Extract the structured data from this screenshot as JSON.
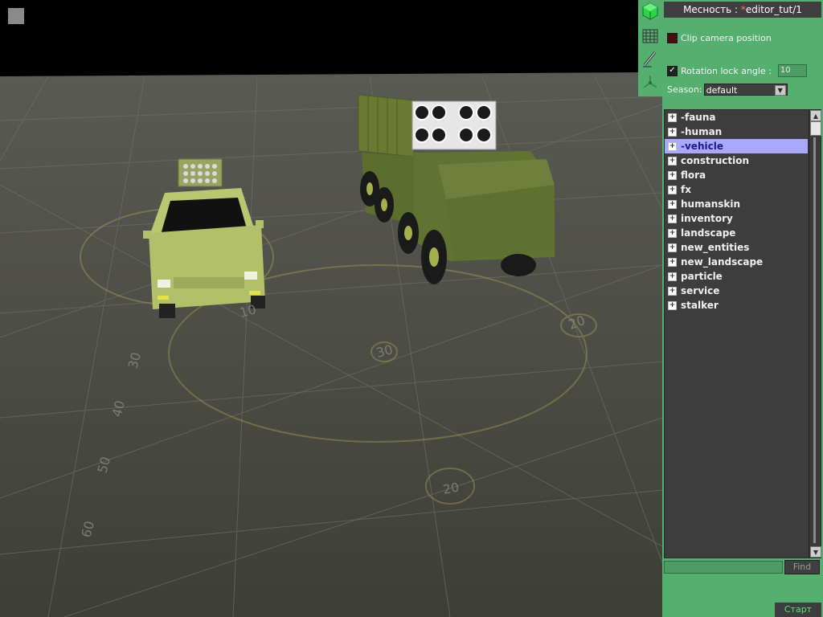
{
  "panel": {
    "title_prefix": "Месность : ",
    "title_dirty_mark": "*",
    "title_map": "editor_tut/1",
    "clip_camera": {
      "label": "Clip camera position",
      "checked": false
    },
    "rotation_lock": {
      "label": "Rotation lock angle :",
      "checked": true,
      "value": "10"
    },
    "season": {
      "label": "Season:",
      "value": "default"
    },
    "tree_items": [
      {
        "label": "-fauna",
        "selected": false
      },
      {
        "label": "-human",
        "selected": false
      },
      {
        "label": "-vehicle",
        "selected": true
      },
      {
        "label": "construction",
        "selected": false
      },
      {
        "label": "flora",
        "selected": false
      },
      {
        "label": "fx",
        "selected": false
      },
      {
        "label": "humanskin",
        "selected": false
      },
      {
        "label": "inventory",
        "selected": false
      },
      {
        "label": "landscape",
        "selected": false
      },
      {
        "label": "new_entities",
        "selected": false
      },
      {
        "label": "new_landscape",
        "selected": false
      },
      {
        "label": "particle",
        "selected": false
      },
      {
        "label": "service",
        "selected": false
      },
      {
        "label": "stalker",
        "selected": false
      }
    ],
    "find_input_value": "",
    "find_label": "Find",
    "start_label": "Старт"
  },
  "tools": [
    {
      "name": "object-cube-icon"
    },
    {
      "name": "grid-icon"
    },
    {
      "name": "brush-tool-icon"
    },
    {
      "name": "axis-gizmo-icon"
    }
  ],
  "viewport": {
    "floor_numbers": [
      "30",
      "20",
      "40",
      "50",
      "60",
      "10",
      "30",
      "20"
    ],
    "ground_color": "#47483f",
    "vehicle_color": "#b2c06a",
    "truck_color": "#5a6b2c"
  }
}
